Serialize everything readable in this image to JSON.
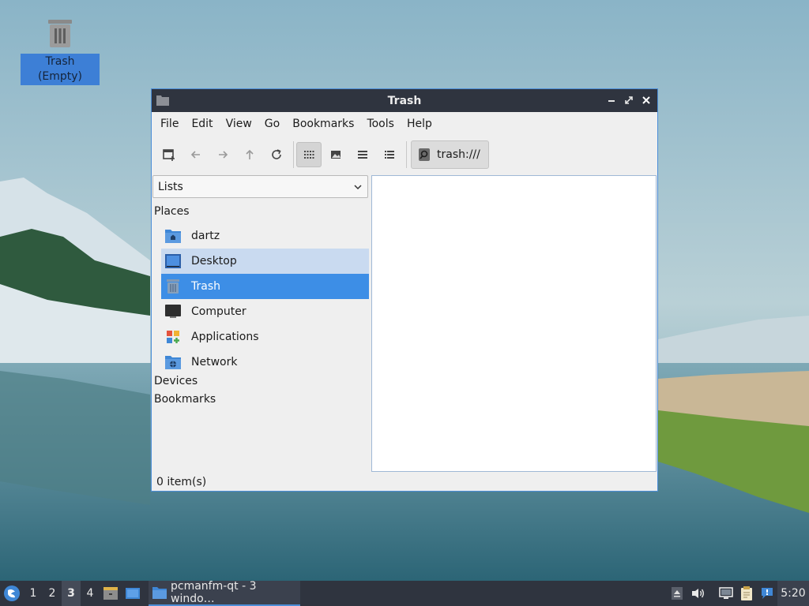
{
  "desktop": {
    "icons": [
      {
        "label": "Trash (Empty)",
        "icon": "trash-icon"
      }
    ]
  },
  "window": {
    "title": "Trash",
    "menu": [
      "File",
      "Edit",
      "View",
      "Go",
      "Bookmarks",
      "Tools",
      "Help"
    ],
    "toolbar": {
      "buttons": [
        "new-tab-icon",
        "back-icon",
        "forward-icon",
        "up-icon",
        "reload-icon",
        "icon-view-icon",
        "thumbnail-view-icon",
        "compact-view-icon",
        "detailed-list-view-icon"
      ],
      "active_view": "icon-view",
      "path": "trash:///"
    },
    "sidebar": {
      "mode": "Lists",
      "sections": {
        "places": "Places",
        "devices": "Devices",
        "bookmarks": "Bookmarks"
      },
      "places": [
        {
          "label": "dartz",
          "icon": "home-folder-icon"
        },
        {
          "label": "Desktop",
          "icon": "desktop-icon",
          "state": "hover"
        },
        {
          "label": "Trash",
          "icon": "trash-icon",
          "state": "selected"
        },
        {
          "label": "Computer",
          "icon": "computer-icon"
        },
        {
          "label": "Applications",
          "icon": "applications-icon"
        },
        {
          "label": "Network",
          "icon": "network-folder-icon"
        }
      ]
    },
    "status": "0 item(s)"
  },
  "taskbar": {
    "desktops": [
      "1",
      "2",
      "3",
      "4"
    ],
    "active_desktop": "3",
    "task_label": "pcmanfm-qt - 3 windo…",
    "clock": "5:20"
  },
  "colors": {
    "accent": "#3d8ee6",
    "panel": "#2f343f",
    "window_border": "#4c8ed8"
  }
}
